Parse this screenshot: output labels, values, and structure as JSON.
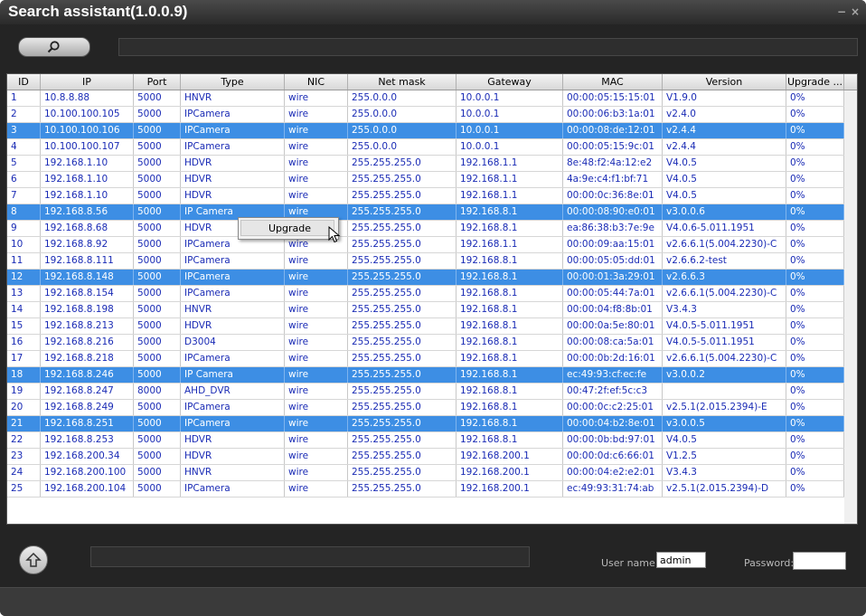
{
  "window": {
    "title": "Search assistant(1.0.0.9)",
    "min_glyph": "−",
    "close_glyph": "×"
  },
  "toolbar": {
    "search_icon": "search-icon",
    "search_value": ""
  },
  "table": {
    "columns": [
      "ID",
      "IP",
      "Port",
      "Type",
      "NIC",
      "Net mask",
      "Gateway",
      "MAC",
      "Version",
      "Upgrade ..."
    ],
    "rows": [
      {
        "id": "1",
        "ip": "10.8.8.88",
        "port": "5000",
        "type": "HNVR",
        "nic": "wire",
        "mask": "255.0.0.0",
        "gw": "10.0.0.1",
        "mac": "00:00:05:15:15:01",
        "ver": "V1.9.0",
        "up": "0%",
        "sel": false
      },
      {
        "id": "2",
        "ip": "10.100.100.105",
        "port": "5000",
        "type": "IPCamera",
        "nic": "wire",
        "mask": "255.0.0.0",
        "gw": "10.0.0.1",
        "mac": "00:00:06:b3:1a:01",
        "ver": "v2.4.0",
        "up": "0%",
        "sel": false
      },
      {
        "id": "3",
        "ip": "10.100.100.106",
        "port": "5000",
        "type": "IPCamera",
        "nic": "wire",
        "mask": "255.0.0.0",
        "gw": "10.0.0.1",
        "mac": "00:00:08:de:12:01",
        "ver": "v2.4.4",
        "up": "0%",
        "sel": true
      },
      {
        "id": "4",
        "ip": "10.100.100.107",
        "port": "5000",
        "type": "IPCamera",
        "nic": "wire",
        "mask": "255.0.0.0",
        "gw": "10.0.0.1",
        "mac": "00:00:05:15:9c:01",
        "ver": "v2.4.4",
        "up": "0%",
        "sel": false
      },
      {
        "id": "5",
        "ip": "192.168.1.10",
        "port": "5000",
        "type": "HDVR",
        "nic": "wire",
        "mask": "255.255.255.0",
        "gw": "192.168.1.1",
        "mac": "8e:48:f2:4a:12:e2",
        "ver": "V4.0.5",
        "up": "0%",
        "sel": false
      },
      {
        "id": "6",
        "ip": "192.168.1.10",
        "port": "5000",
        "type": "HDVR",
        "nic": "wire",
        "mask": "255.255.255.0",
        "gw": "192.168.1.1",
        "mac": "4a:9e:c4:f1:bf:71",
        "ver": "V4.0.5",
        "up": "0%",
        "sel": false
      },
      {
        "id": "7",
        "ip": "192.168.1.10",
        "port": "5000",
        "type": "HDVR",
        "nic": "wire",
        "mask": "255.255.255.0",
        "gw": "192.168.1.1",
        "mac": "00:00:0c:36:8e:01",
        "ver": "V4.0.5",
        "up": "0%",
        "sel": false
      },
      {
        "id": "8",
        "ip": "192.168.8.56",
        "port": "5000",
        "type": "IP Camera",
        "nic": "wire",
        "mask": "255.255.255.0",
        "gw": "192.168.8.1",
        "mac": "00:00:08:90:e0:01",
        "ver": "v3.0.0.6",
        "up": "0%",
        "sel": true
      },
      {
        "id": "9",
        "ip": "192.168.8.68",
        "port": "5000",
        "type": "HDVR",
        "nic": "wire",
        "mask": "255.255.255.0",
        "gw": "192.168.8.1",
        "mac": "ea:86:38:b3:7e:9e",
        "ver": "V4.0.6-5.011.1951",
        "up": "0%",
        "sel": false
      },
      {
        "id": "10",
        "ip": "192.168.8.92",
        "port": "5000",
        "type": "IPCamera",
        "nic": "wire",
        "mask": "255.255.255.0",
        "gw": "192.168.1.1",
        "mac": "00:00:09:aa:15:01",
        "ver": "v2.6.6.1(5.004.2230)-C",
        "up": "0%",
        "sel": false
      },
      {
        "id": "11",
        "ip": "192.168.8.111",
        "port": "5000",
        "type": "IPCamera",
        "nic": "wire",
        "mask": "255.255.255.0",
        "gw": "192.168.8.1",
        "mac": "00:00:05:05:dd:01",
        "ver": "v2.6.6.2-test",
        "up": "0%",
        "sel": false
      },
      {
        "id": "12",
        "ip": "192.168.8.148",
        "port": "5000",
        "type": "IPCamera",
        "nic": "wire",
        "mask": "255.255.255.0",
        "gw": "192.168.8.1",
        "mac": "00:00:01:3a:29:01",
        "ver": "v2.6.6.3",
        "up": "0%",
        "sel": true
      },
      {
        "id": "13",
        "ip": "192.168.8.154",
        "port": "5000",
        "type": "IPCamera",
        "nic": "wire",
        "mask": "255.255.255.0",
        "gw": "192.168.8.1",
        "mac": "00:00:05:44:7a:01",
        "ver": "v2.6.6.1(5.004.2230)-C",
        "up": "0%",
        "sel": false
      },
      {
        "id": "14",
        "ip": "192.168.8.198",
        "port": "5000",
        "type": "HNVR",
        "nic": "wire",
        "mask": "255.255.255.0",
        "gw": "192.168.8.1",
        "mac": "00:00:04:f8:8b:01",
        "ver": "V3.4.3",
        "up": "0%",
        "sel": false
      },
      {
        "id": "15",
        "ip": "192.168.8.213",
        "port": "5000",
        "type": "HDVR",
        "nic": "wire",
        "mask": "255.255.255.0",
        "gw": "192.168.8.1",
        "mac": "00:00:0a:5e:80:01",
        "ver": "V4.0.5-5.011.1951",
        "up": "0%",
        "sel": false
      },
      {
        "id": "16",
        "ip": "192.168.8.216",
        "port": "5000",
        "type": "D3004",
        "nic": "wire",
        "mask": "255.255.255.0",
        "gw": "192.168.8.1",
        "mac": "00:00:08:ca:5a:01",
        "ver": "V4.0.5-5.011.1951",
        "up": "0%",
        "sel": false
      },
      {
        "id": "17",
        "ip": "192.168.8.218",
        "port": "5000",
        "type": "IPCamera",
        "nic": "wire",
        "mask": "255.255.255.0",
        "gw": "192.168.8.1",
        "mac": "00:00:0b:2d:16:01",
        "ver": "v2.6.6.1(5.004.2230)-C",
        "up": "0%",
        "sel": false
      },
      {
        "id": "18",
        "ip": "192.168.8.246",
        "port": "5000",
        "type": "IP Camera",
        "nic": "wire",
        "mask": "255.255.255.0",
        "gw": "192.168.8.1",
        "mac": "ec:49:93:cf:ec:fe",
        "ver": "v3.0.0.2",
        "up": "0%",
        "sel": true
      },
      {
        "id": "19",
        "ip": "192.168.8.247",
        "port": "8000",
        "type": "AHD_DVR",
        "nic": "wire",
        "mask": "255.255.255.0",
        "gw": "192.168.8.1",
        "mac": "00:47:2f:ef:5c:c3",
        "ver": "",
        "up": "0%",
        "sel": false
      },
      {
        "id": "20",
        "ip": "192.168.8.249",
        "port": "5000",
        "type": "IPCamera",
        "nic": "wire",
        "mask": "255.255.255.0",
        "gw": "192.168.8.1",
        "mac": "00:00:0c:c2:25:01",
        "ver": "v2.5.1(2.015.2394)-E",
        "up": "0%",
        "sel": false
      },
      {
        "id": "21",
        "ip": "192.168.8.251",
        "port": "5000",
        "type": "IPCamera",
        "nic": "wire",
        "mask": "255.255.255.0",
        "gw": "192.168.8.1",
        "mac": "00:00:04:b2:8e:01",
        "ver": "v3.0.0.5",
        "up": "0%",
        "sel": true
      },
      {
        "id": "22",
        "ip": "192.168.8.253",
        "port": "5000",
        "type": "HDVR",
        "nic": "wire",
        "mask": "255.255.255.0",
        "gw": "192.168.8.1",
        "mac": "00:00:0b:bd:97:01",
        "ver": "V4.0.5",
        "up": "0%",
        "sel": false
      },
      {
        "id": "23",
        "ip": "192.168.200.34",
        "port": "5000",
        "type": "HDVR",
        "nic": "wire",
        "mask": "255.255.255.0",
        "gw": "192.168.200.1",
        "mac": "00:00:0d:c6:66:01",
        "ver": "V1.2.5",
        "up": "0%",
        "sel": false
      },
      {
        "id": "24",
        "ip": "192.168.200.100",
        "port": "5000",
        "type": "HNVR",
        "nic": "wire",
        "mask": "255.255.255.0",
        "gw": "192.168.200.1",
        "mac": "00:00:04:e2:e2:01",
        "ver": "V3.4.3",
        "up": "0%",
        "sel": false
      },
      {
        "id": "25",
        "ip": "192.168.200.104",
        "port": "5000",
        "type": "IPCamera",
        "nic": "wire",
        "mask": "255.255.255.0",
        "gw": "192.168.200.1",
        "mac": "ec:49:93:31:74:ab",
        "ver": "v2.5.1(2.015.2394)-D",
        "up": "0%",
        "sel": false
      }
    ]
  },
  "context_menu": {
    "upgrade_label": "Upgrade"
  },
  "footer": {
    "upload_icon": "upload-arrow-icon",
    "user_label": "User name:",
    "user_value": "admin",
    "password_label": "Password:",
    "password_value": ""
  }
}
